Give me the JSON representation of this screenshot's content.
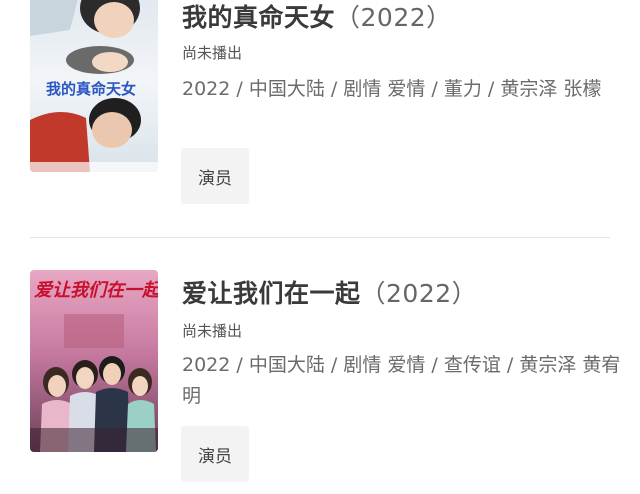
{
  "items": [
    {
      "title": "我的真命天女",
      "year": "（2022）",
      "status": "尚未播出",
      "meta": "2022 / 中国大陆 / 剧情 爱情 / 董力 / 黄宗泽 张檬",
      "cast_label": "演员",
      "poster_text": "我的真命天女"
    },
    {
      "title": "爱让我们在一起",
      "year": "（2022）",
      "status": "尚未播出",
      "meta": "2022 / 中国大陆 / 剧情 爱情 / 查传谊 / 黄宗泽 黄宥明",
      "cast_label": "演员",
      "poster_text": "爱让我们在一起"
    }
  ],
  "colors": {
    "title": "#3a3a3a",
    "meta": "#6b6b6b",
    "button_bg": "#f3f3f3",
    "divider": "#e4e4e4"
  }
}
